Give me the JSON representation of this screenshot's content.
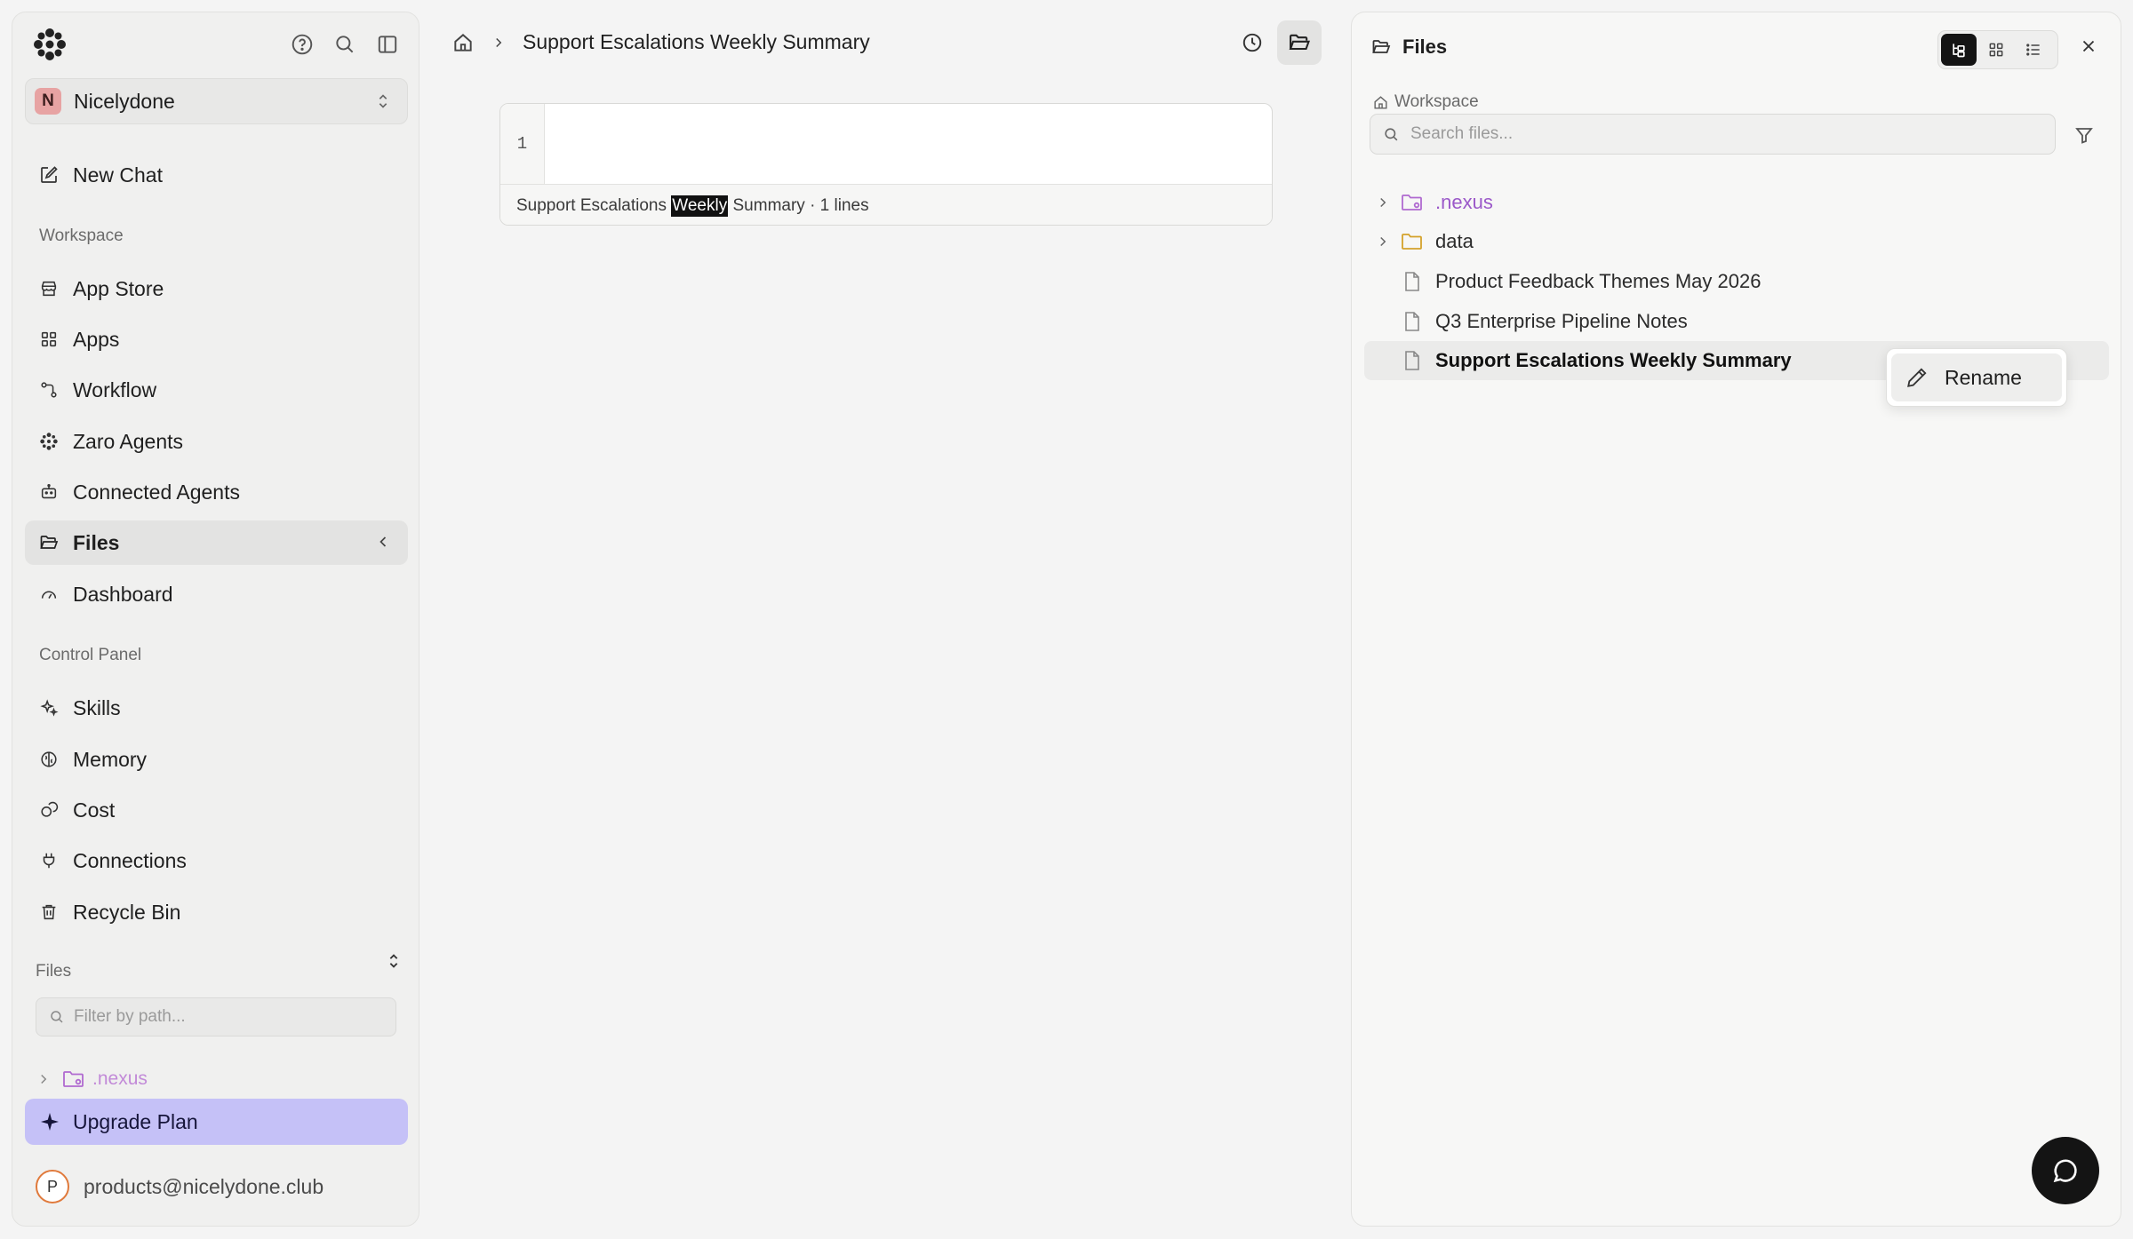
{
  "sidebar": {
    "workspace_name": "Nicelydone",
    "workspace_initial": "N",
    "new_chat": "New Chat",
    "workspace_label": "Workspace",
    "workspace_items": [
      {
        "label": "App Store",
        "icon": "store-icon"
      },
      {
        "label": "Apps",
        "icon": "grid-icon"
      },
      {
        "label": "Workflow",
        "icon": "workflow-icon"
      },
      {
        "label": "Zaro Agents",
        "icon": "agents-icon"
      },
      {
        "label": "Connected Agents",
        "icon": "bot-icon"
      },
      {
        "label": "Files",
        "icon": "folder-open-icon",
        "active": true
      },
      {
        "label": "Dashboard",
        "icon": "gauge-icon"
      }
    ],
    "control_label": "Control Panel",
    "control_items": [
      {
        "label": "Skills",
        "icon": "sparkles-icon"
      },
      {
        "label": "Memory",
        "icon": "brain-icon"
      },
      {
        "label": "Cost",
        "icon": "coins-icon"
      },
      {
        "label": "Connections",
        "icon": "plug-icon"
      },
      {
        "label": "Recycle Bin",
        "icon": "trash-icon"
      }
    ],
    "files_label": "Files",
    "files_filter_placeholder": "Filter by path...",
    "files_tree": [
      {
        "label": ".nexus",
        "color": "#b06ad0"
      }
    ],
    "upgrade": "Upgrade Plan",
    "user_initial": "P",
    "user_email": "products@nicelydone.club"
  },
  "header": {
    "breadcrumb_title": "Support Escalations Weekly Summary"
  },
  "editor": {
    "line_number": "1",
    "footer_before": "Support Escalations ",
    "footer_highlight": "Weekly",
    "footer_after": " Summary · 1 lines"
  },
  "files_panel": {
    "title": "Files",
    "workspace": "Workspace",
    "search_placeholder": "Search files...",
    "tree": [
      {
        "label": ".nexus",
        "type": "folder",
        "color": "#9b59c9"
      },
      {
        "label": "data",
        "type": "folder",
        "color": "#d4a22a"
      },
      {
        "label": "Product Feedback Themes May 2026",
        "type": "file"
      },
      {
        "label": "Q3 Enterprise Pipeline Notes",
        "type": "file"
      },
      {
        "label": "Support Escalations Weekly Summary",
        "type": "file",
        "selected": true
      }
    ],
    "context_menu": {
      "rename": "Rename"
    }
  },
  "colors": {
    "accent_upgrade": "#c5c1f7",
    "nexus_folder": "#b06ad0",
    "data_folder": "#d4a22a",
    "dark": "#141414"
  }
}
